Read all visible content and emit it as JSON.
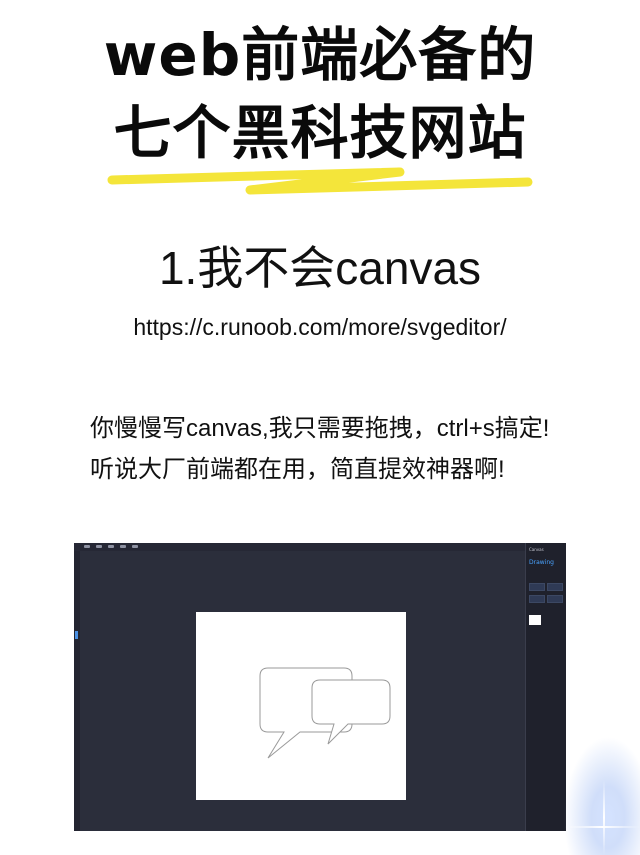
{
  "headline": {
    "line1": "web前端必备的",
    "line2": "七个黑科技网站"
  },
  "accent": {
    "highlight": "#f4e53a"
  },
  "section": {
    "title": "1.我不会canvas",
    "url": "https://c.runoob.com/more/svgeditor/",
    "description": "你慢慢写canvas,我只需要拖拽，ctrl+s搞定!听说大厂前端都在用，简直提效神器啊!"
  },
  "editor": {
    "panel_title": "Canvas",
    "panel_tab": "Drawing",
    "background": "#2b2e3b",
    "shapes": "speech-bubbles-icon"
  }
}
